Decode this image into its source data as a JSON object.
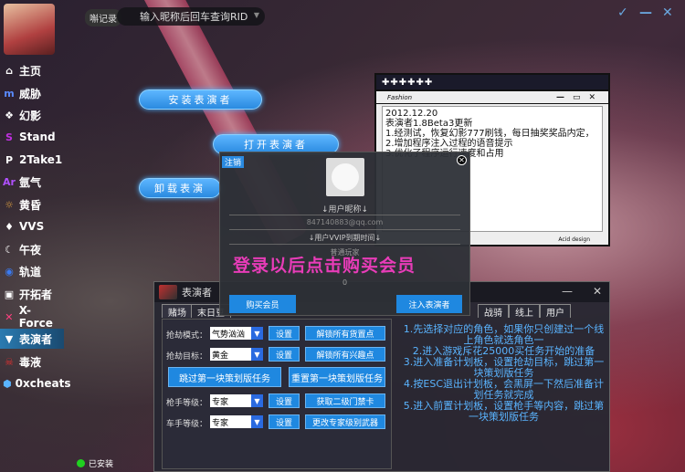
{
  "topbar": {
    "tag": "嘝记录",
    "input_value": "输入昵称后回车查询RID",
    "controls": [
      "✓",
      "—",
      "✕"
    ]
  },
  "sidebar": {
    "items": [
      {
        "label": "主页",
        "icon": "home-icon",
        "glyph": "⌂",
        "color": "#ffffff"
      },
      {
        "label": "威胁",
        "icon": "threat-icon",
        "glyph": "m",
        "color": "#5a8aff"
      },
      {
        "label": "幻影",
        "icon": "phantom-icon",
        "glyph": "❖",
        "color": "#ffffff"
      },
      {
        "label": "Stand",
        "icon": "stand-icon",
        "glyph": "S",
        "color": "#c030e0"
      },
      {
        "label": "2Take1",
        "icon": "2take1-icon",
        "glyph": "P",
        "color": "#ffffff"
      },
      {
        "label": "氩气",
        "icon": "argon-icon",
        "glyph": "Ar",
        "color": "#b050ff"
      },
      {
        "label": "黄昏",
        "icon": "dusk-icon",
        "glyph": "☼",
        "color": "#e0a040"
      },
      {
        "label": "VVS",
        "icon": "vvs-icon",
        "glyph": "♦",
        "color": "#ffffff"
      },
      {
        "label": "午夜",
        "icon": "midnight-icon",
        "glyph": "☾",
        "color": "#ffffff"
      },
      {
        "label": "轨道",
        "icon": "orbit-icon",
        "glyph": "◉",
        "color": "#3a7af0"
      },
      {
        "label": "开拓者",
        "icon": "pioneer-icon",
        "glyph": "▣",
        "color": "#ffffff"
      },
      {
        "label": "X-Force",
        "icon": "xforce-icon",
        "glyph": "✕",
        "color": "#ff4080"
      },
      {
        "label": "表演者",
        "icon": "performer-icon",
        "glyph": "▼",
        "color": "#ffffff",
        "active": true
      },
      {
        "label": "毒液",
        "icon": "venom-icon",
        "glyph": "☠",
        "color": "#e03030"
      },
      {
        "label": "0xcheats",
        "icon": "0xcheats-icon",
        "glyph": "⬢",
        "color": "#5ab4ff"
      }
    ]
  },
  "pills": [
    "安装表演者",
    "打开表演者",
    "卸载表演"
  ],
  "note": {
    "title": "✚✚✚✚✚✚",
    "bar": "Fashion",
    "controls": [
      "—",
      "▭",
      "✕"
    ],
    "lines": [
      "2012.12.20",
      "表演者1.8Beta3更新",
      "1.经测试，恢复幻影777刷钱，每日抽奖奖品内定，",
      "2.增加程序注入过程的语音提示",
      "3.优化了程序运行速度和占用"
    ],
    "footer": "Acid design"
  },
  "login": {
    "tag": "注销",
    "nickname": "↓用户昵称↓",
    "email": "847140883@qq.com",
    "vip": "↓用户VVIP到期时间↓",
    "status": "普通玩家",
    "zero": "0",
    "buy": "购买会员",
    "inject": "注入表演者"
  },
  "promo": "登录以后点击购买会员",
  "main": {
    "title": "表演者",
    "tabs": [
      "赌场",
      "末日豆",
      "战骑",
      "线上",
      "用户"
    ],
    "rows": {
      "mode_label": "抢劫模式：",
      "mode_value": "气势汹汹",
      "target_label": "抢劫目标：",
      "target_value": "黄金",
      "hand_label": "枪手等级：",
      "hand_value": "专家",
      "driver_label": "车手等级：",
      "driver_value": "专家"
    },
    "buttons": {
      "set": "设置",
      "unlock_pass": "解锁所有货置点",
      "unlock_interest": "解锁所有兴趣点",
      "skip_first": "跳过第一块策划版任务",
      "reset_first": "重置第一块策划版任务",
      "get_card": "获取二级门禁卡",
      "change_weapon": "更改专家级别武器"
    },
    "instructions": [
      "1.先选择对应的角色，如果你只创建过一个线上角色就选角色一",
      "2.进入游戏斥花25000买任务开始的准备",
      "3.进入准备计划板，设置抢劫目标，跳过第一块策划版任务",
      "4.按ESC退出计划板，会黑屏一下然后准备计划任务就完成",
      "5.进入前置计划板，设置枪手等内容，跳过第一块策划版任务"
    ]
  },
  "status": "已安装"
}
